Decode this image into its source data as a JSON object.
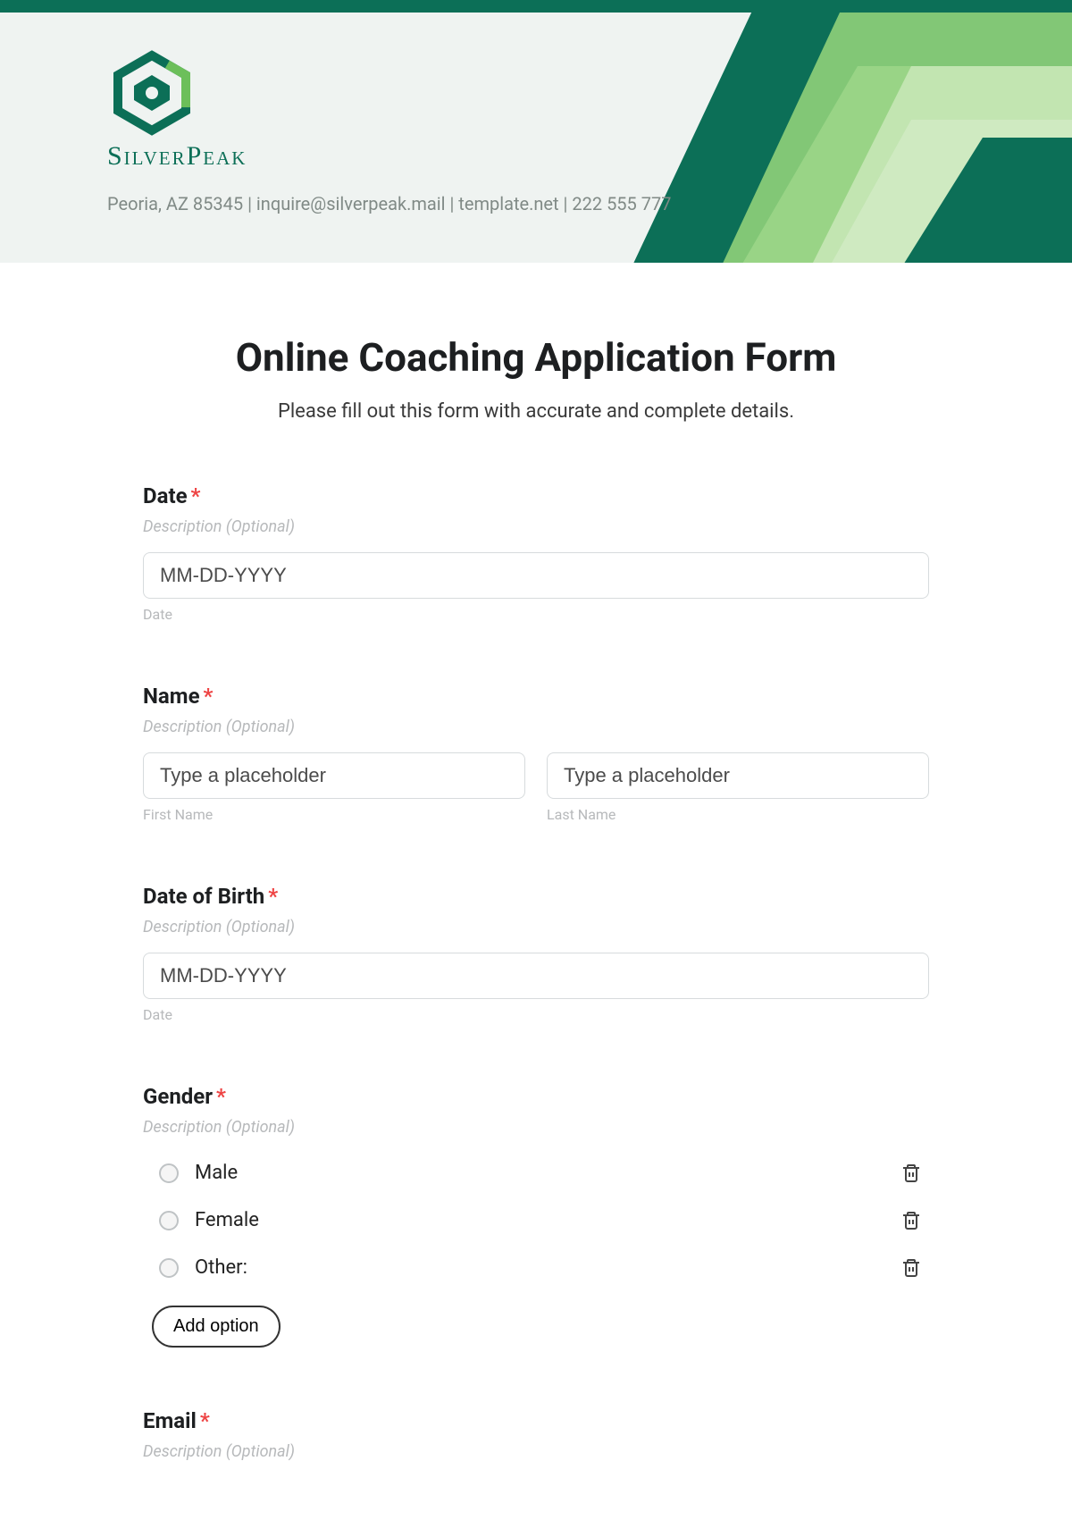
{
  "brand": {
    "name": "SilverPeak",
    "contact": "Peoria, AZ 85345 | inquire@silverpeak.mail | template.net | 222 555 777"
  },
  "form": {
    "title": "Online Coaching Application Form",
    "subtitle": "Please fill out this form with accurate and complete details."
  },
  "fields": {
    "date": {
      "label": "Date",
      "desc": "Description (Optional)",
      "placeholder": "MM-DD-YYYY",
      "sublabel": "Date"
    },
    "name": {
      "label": "Name",
      "desc": "Description (Optional)",
      "first_placeholder": "Type a placeholder",
      "last_placeholder": "Type a placeholder",
      "first_sub": "First Name",
      "last_sub": "Last Name"
    },
    "dob": {
      "label": "Date of Birth",
      "desc": "Description (Optional)",
      "placeholder": "MM-DD-YYYY",
      "sublabel": "Date"
    },
    "gender": {
      "label": "Gender",
      "desc": "Description (Optional)",
      "options": [
        "Male",
        "Female",
        "Other:"
      ],
      "add": "Add option"
    },
    "email": {
      "label": "Email",
      "desc": "Description (Optional)"
    }
  },
  "required_mark": "*"
}
